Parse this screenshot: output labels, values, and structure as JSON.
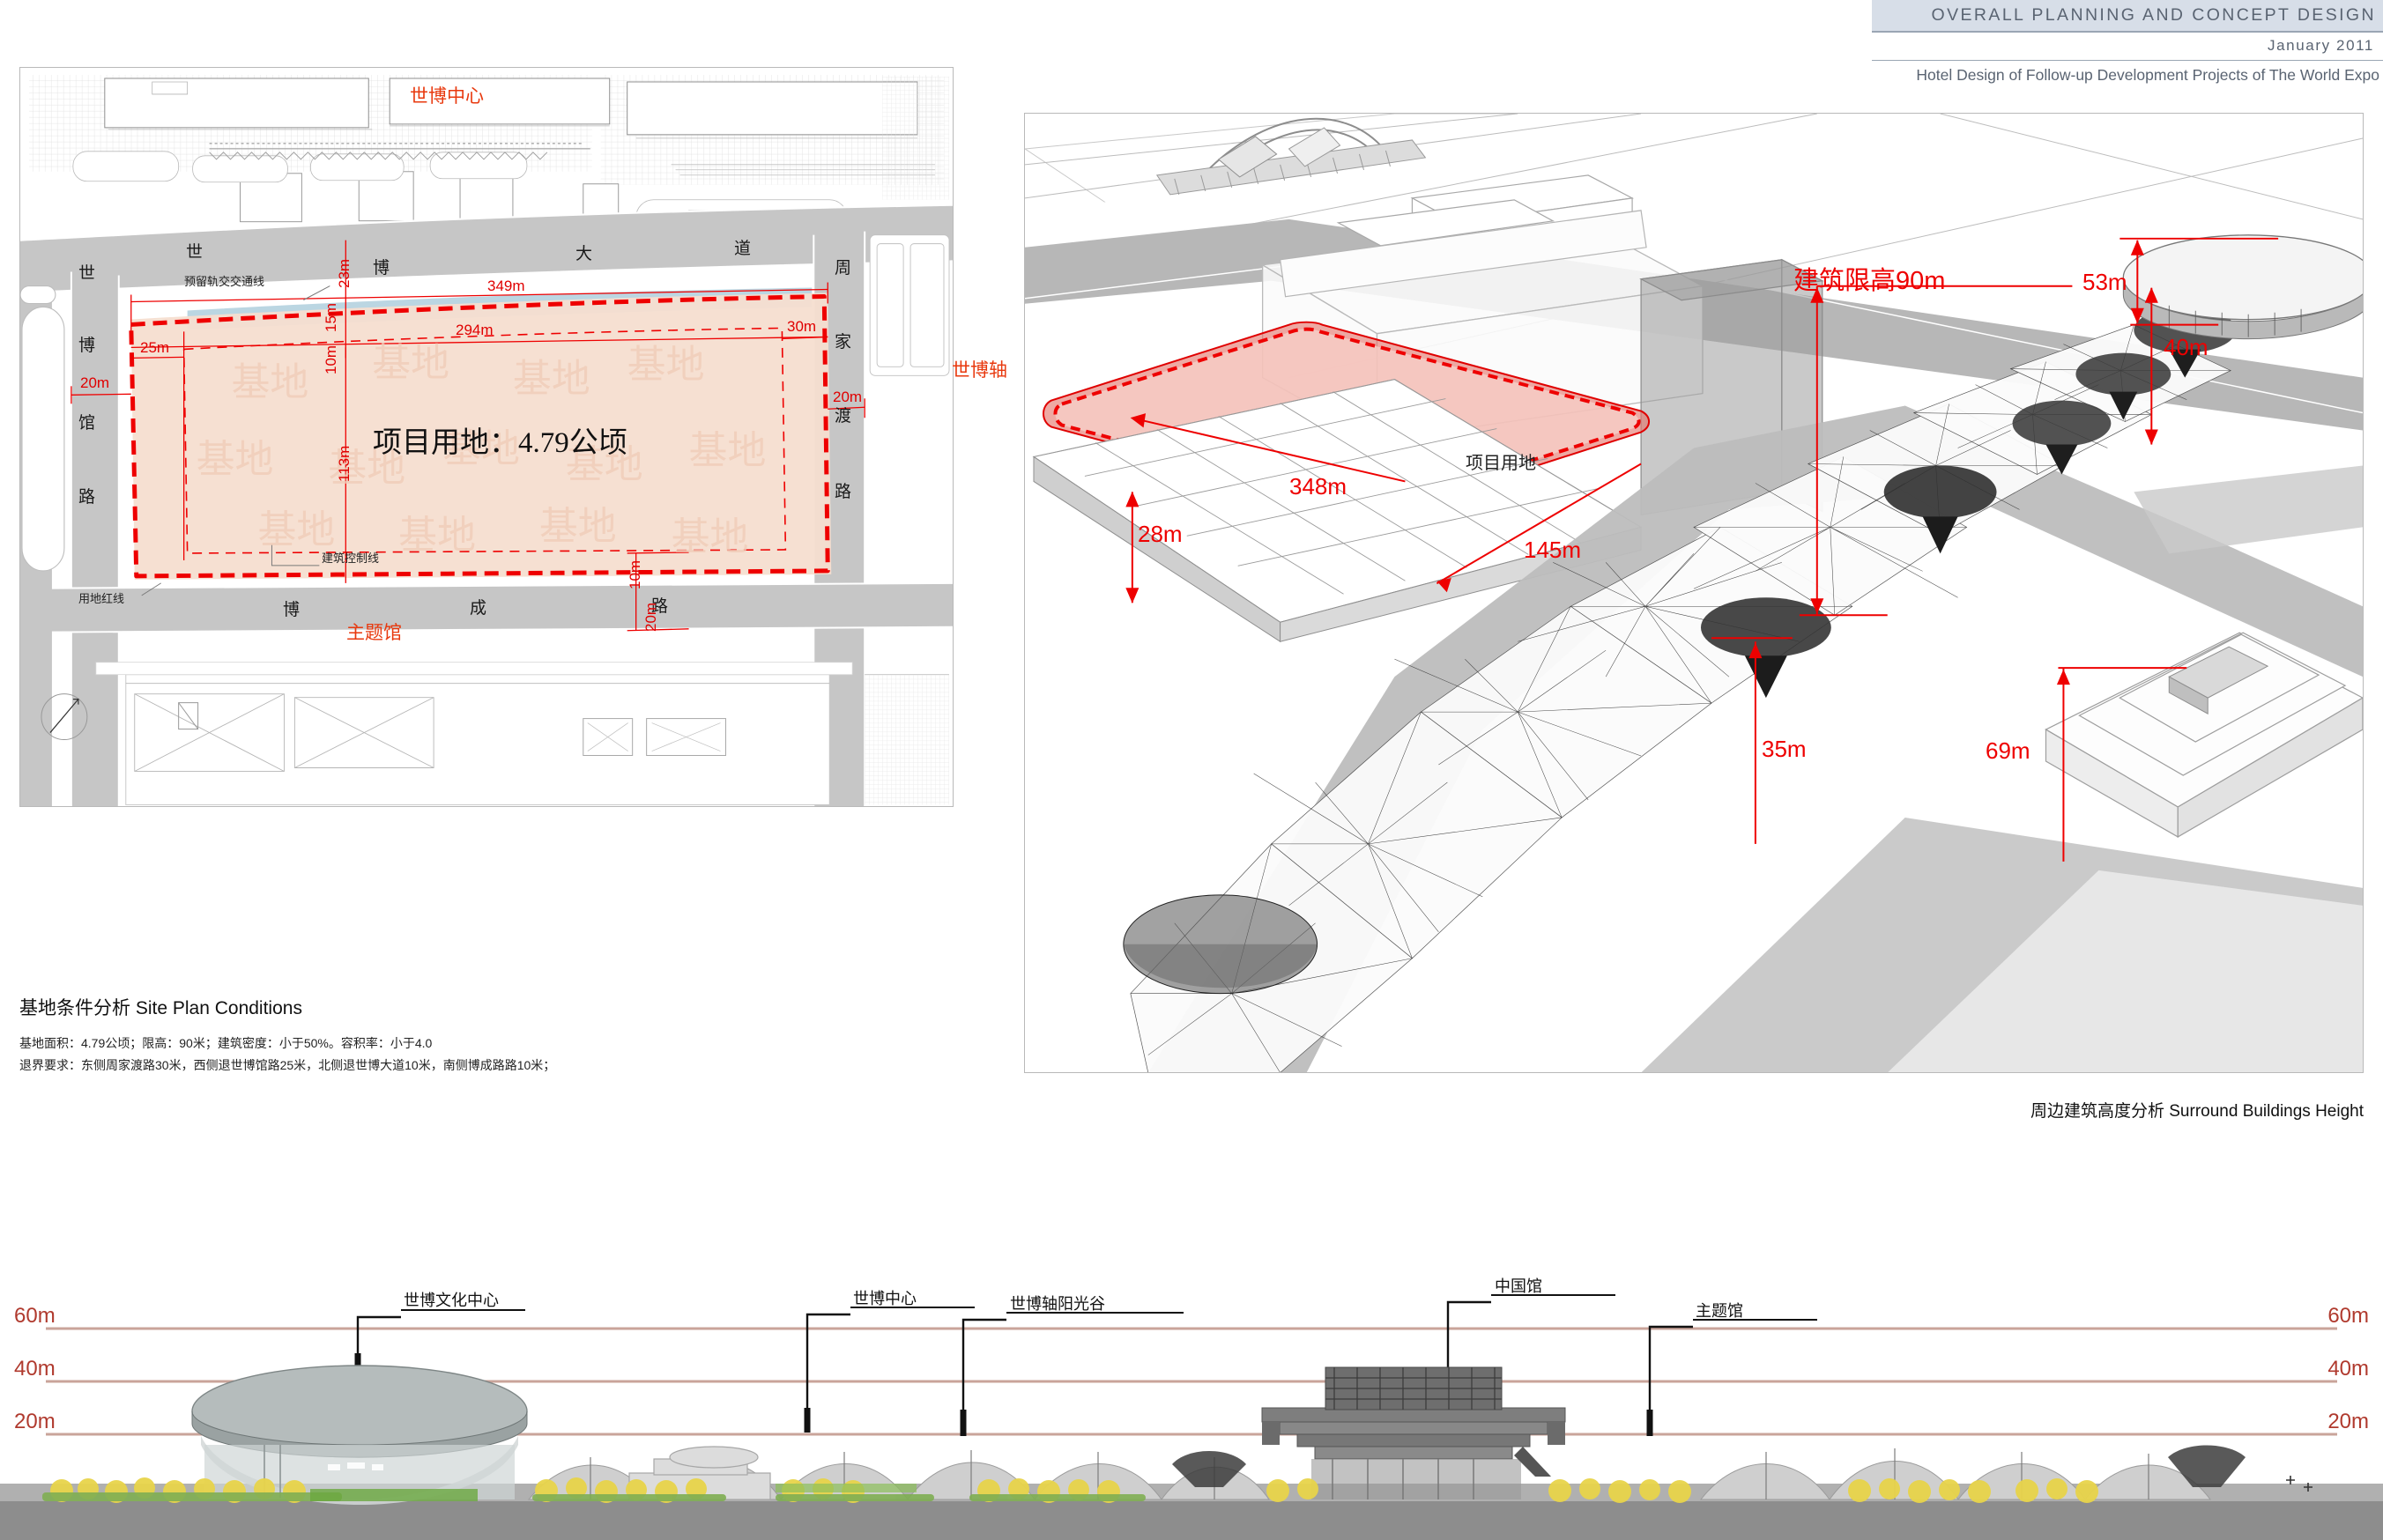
{
  "header": {
    "title": "OVERALL PLANNING AND CONCEPT DESIGN",
    "date": "January  2011",
    "subtitle": "Hotel Design of Follow-up Development Projects of The World Expo"
  },
  "site_plan": {
    "area_text": "项目用地：4.79公顷",
    "place_labels": [
      {
        "text": "世博中心",
        "color": "#e8380d"
      },
      {
        "text": "主题馆",
        "color": "#e8380d"
      },
      {
        "text": "世博轴",
        "color": "#e8380d"
      }
    ],
    "road_chars": {
      "shi_top": "世",
      "bo_top": "博",
      "da": "大",
      "dao": "道",
      "shi_left": "世",
      "bo_left": "博",
      "guan": "馆",
      "lu_left": "路",
      "bo_bottom": "博",
      "cheng": "成",
      "lu_bottom": "路",
      "zhou": "周",
      "jia": "家",
      "du": "渡",
      "lu_right": "路"
    },
    "annotations": {
      "rail_line": "预留轨交交通线",
      "building_control_line": "建筑控制线",
      "red_line": "用地红线"
    },
    "dimensions": {
      "top_length": "349m",
      "inner_length": "294m",
      "inner_depth": "113m",
      "setback_west": "25m",
      "setback_east": "30m",
      "setback_north_road": "23m",
      "setback_north_inner": "15m",
      "offset_10m_top": "10m",
      "offset_10m_bottom": "10m",
      "setback_south": "20m",
      "setback_left_20": "20m",
      "setback_right_20": "20m"
    },
    "watermark": "基地"
  },
  "aerial": {
    "height_limit_label": "建筑限高90m",
    "site_label": "项目用地",
    "dim_length": "348m",
    "dim_width": "145m",
    "building_heights": [
      "40m",
      "53m",
      "69m",
      "28m",
      "35m"
    ]
  },
  "captions": {
    "site_plan_title": "基地条件分析  Site Plan Conditions",
    "site_plan_line1": "基地面积：4.79公顷；限高：90米；建筑密度：小于50%。容积率：小于4.0",
    "site_plan_line2": "退界要求：东侧周家渡路30米，西侧退世博馆路25米，北侧退世博大道10米，南侧博成路路10米；",
    "aerial_title": "周边建筑高度分析  Surround Buildings Height"
  },
  "elevation": {
    "levels_left": [
      "60m",
      "40m",
      "20m"
    ],
    "levels_right": [
      "60m",
      "40m",
      "20m"
    ],
    "callouts": [
      {
        "text": "世博文化中心"
      },
      {
        "text": "世博中心"
      },
      {
        "text": "世博轴阳光谷"
      },
      {
        "text": "中国馆"
      },
      {
        "text": "主题馆"
      }
    ]
  },
  "colors": {
    "accent_red": "#e00000",
    "orange_red": "#e8380d",
    "header_band": "#d7dee8",
    "header_text": "#5a6472",
    "elevation_line": "#c9a49a",
    "elevation_label": "#b03a2e",
    "site_fill": "#f6ded0"
  }
}
